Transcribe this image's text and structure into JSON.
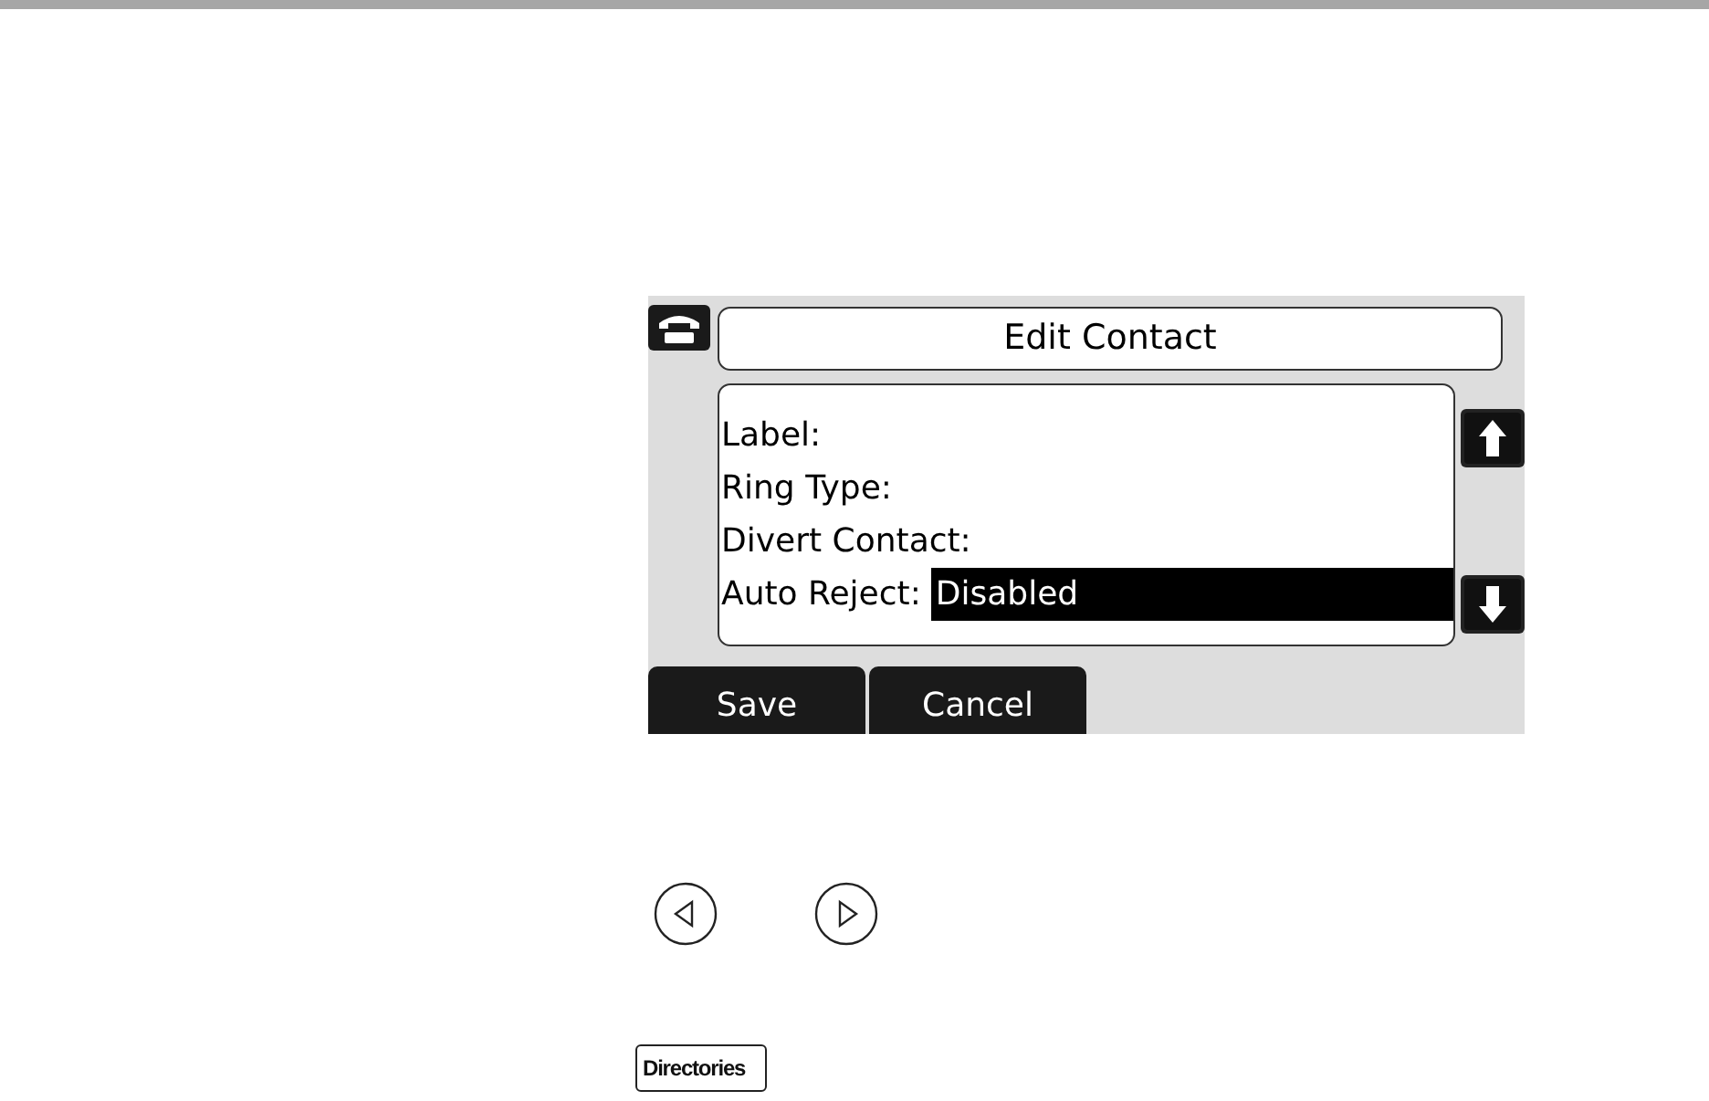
{
  "screen": {
    "title": "Edit Contact",
    "fields": [
      {
        "label": "Label:",
        "selected": false
      },
      {
        "label": "Ring Type:",
        "selected": false
      },
      {
        "label": "Divert Contact:",
        "selected": false
      },
      {
        "label": "Auto Reject:",
        "value": "Disabled",
        "selected": true
      }
    ],
    "softkeys": [
      "Save",
      "Cancel"
    ]
  },
  "hard_key": {
    "label": "Directories"
  }
}
